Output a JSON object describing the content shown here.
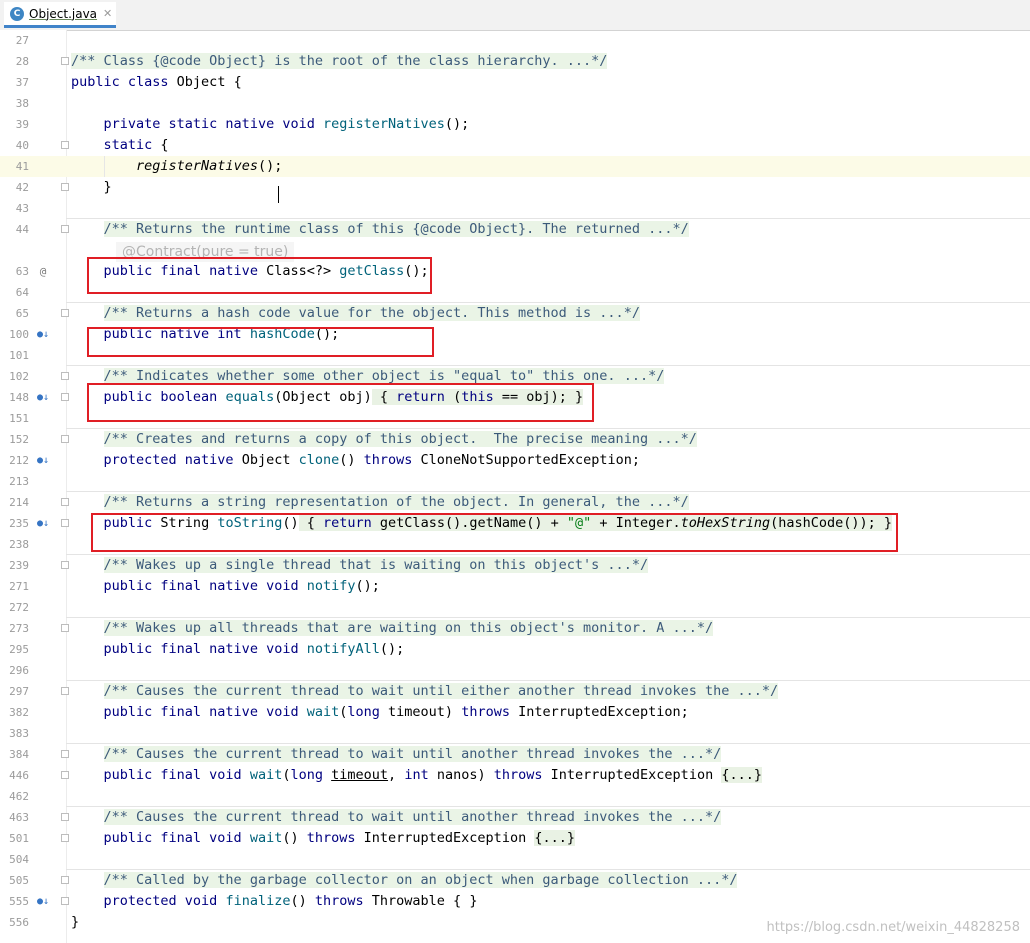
{
  "tab": {
    "icon": "java-class-icon",
    "icon_letter": "C",
    "filename": "Object.java",
    "close_symbol": "✕"
  },
  "inlay_hint": "@Contract(pure = true)",
  "watermark": "https://blog.csdn.net/weixin_44828258",
  "lines": [
    {
      "num": "27",
      "tokens": []
    },
    {
      "num": "28",
      "fold": true,
      "tokens": [
        {
          "t": "/** Class {@code Object} is the root of the class hierarchy. ...*/",
          "c": "doc"
        }
      ]
    },
    {
      "num": "37",
      "tokens": [
        {
          "t": "public class",
          "c": "kw"
        },
        {
          "t": " Object {"
        }
      ]
    },
    {
      "num": "38",
      "tokens": []
    },
    {
      "num": "39",
      "tokens": [
        {
          "t": "    "
        },
        {
          "t": "private static native void",
          "c": "kw"
        },
        {
          "t": " "
        },
        {
          "t": "registerNatives",
          "c": "mth"
        },
        {
          "t": "();"
        }
      ]
    },
    {
      "num": "40",
      "fold": true,
      "tokens": [
        {
          "t": "    "
        },
        {
          "t": "static",
          "c": "kw"
        },
        {
          "t": " {"
        }
      ]
    },
    {
      "num": "41",
      "current": true,
      "tokens": [
        {
          "t": "        "
        },
        {
          "t": "registerNatives",
          "c": "it"
        },
        {
          "t": "();"
        }
      ]
    },
    {
      "num": "42",
      "fold": true,
      "tokens": [
        {
          "t": "    }"
        }
      ]
    },
    {
      "num": "43",
      "tokens": []
    },
    {
      "num": "44",
      "fold": true,
      "tokens": [
        {
          "t": "    "
        },
        {
          "t": "/** Returns the runtime class of this {@code Object}. The returned ...*/",
          "c": "doc"
        }
      ]
    },
    {
      "num": "",
      "tokens": []
    },
    {
      "num": "63",
      "icon": "@",
      "tokens": [
        {
          "t": "    "
        },
        {
          "t": "public final native",
          "c": "kw"
        },
        {
          "t": " Class<?> "
        },
        {
          "t": "getClass",
          "c": "mth"
        },
        {
          "t": "();"
        }
      ]
    },
    {
      "num": "64",
      "tokens": []
    },
    {
      "num": "65",
      "fold": true,
      "tokens": [
        {
          "t": "    "
        },
        {
          "t": "/** Returns a hash code value for the object. This method is ...*/",
          "c": "doc"
        }
      ]
    },
    {
      "num": "100",
      "icon": "override",
      "tokens": [
        {
          "t": "    "
        },
        {
          "t": "public native int",
          "c": "kw"
        },
        {
          "t": " "
        },
        {
          "t": "hashCode",
          "c": "mth"
        },
        {
          "t": "();"
        }
      ]
    },
    {
      "num": "101",
      "tokens": []
    },
    {
      "num": "102",
      "fold": true,
      "tokens": [
        {
          "t": "    "
        },
        {
          "t": "/** Indicates whether some other object is \"equal to\" this one. ...*/",
          "c": "doc"
        }
      ]
    },
    {
      "num": "148",
      "icon": "override",
      "fold": true,
      "tokens": [
        {
          "t": "    "
        },
        {
          "t": "public boolean",
          "c": "kw"
        },
        {
          "t": " "
        },
        {
          "t": "equals",
          "c": "mth"
        },
        {
          "t": "(Object obj)"
        },
        {
          "t": " { ",
          "c": "fb"
        },
        {
          "t": "return",
          "c": "kw fb"
        },
        {
          "t": " (",
          "c": "fb"
        },
        {
          "t": "this",
          "c": "kw fb"
        },
        {
          "t": " == obj); ",
          "c": "fb"
        },
        {
          "t": "}",
          "c": "fb"
        }
      ]
    },
    {
      "num": "151",
      "tokens": []
    },
    {
      "num": "152",
      "fold": true,
      "tokens": [
        {
          "t": "    "
        },
        {
          "t": "/** Creates and returns a copy of this object.  The precise meaning ...*/",
          "c": "doc"
        }
      ]
    },
    {
      "num": "212",
      "icon": "override",
      "tokens": [
        {
          "t": "    "
        },
        {
          "t": "protected native",
          "c": "kw"
        },
        {
          "t": " Object "
        },
        {
          "t": "clone",
          "c": "mth"
        },
        {
          "t": "() "
        },
        {
          "t": "throws",
          "c": "kw"
        },
        {
          "t": " CloneNotSupportedException;"
        }
      ]
    },
    {
      "num": "213",
      "tokens": []
    },
    {
      "num": "214",
      "fold": true,
      "tokens": [
        {
          "t": "    "
        },
        {
          "t": "/** Returns a string representation of the object. In general, the ...*/",
          "c": "doc"
        }
      ]
    },
    {
      "num": "235",
      "icon": "override",
      "fold": true,
      "tokens": [
        {
          "t": "    "
        },
        {
          "t": "public",
          "c": "kw"
        },
        {
          "t": " String "
        },
        {
          "t": "toString",
          "c": "mth"
        },
        {
          "t": "()"
        },
        {
          "t": " { ",
          "c": "fb"
        },
        {
          "t": "return",
          "c": "kw fb"
        },
        {
          "t": " getClass().getName() + ",
          "c": "fb"
        },
        {
          "t": "\"@\"",
          "c": "str fb"
        },
        {
          "t": " + Integer.",
          "c": "fb"
        },
        {
          "t": "toHexString",
          "c": "it fb"
        },
        {
          "t": "(hashCode()); ",
          "c": "fb"
        },
        {
          "t": "}",
          "c": "fb"
        }
      ]
    },
    {
      "num": "238",
      "tokens": []
    },
    {
      "num": "239",
      "fold": true,
      "tokens": [
        {
          "t": "    "
        },
        {
          "t": "/** Wakes up a single thread that is waiting on this object's ...*/",
          "c": "doc"
        }
      ]
    },
    {
      "num": "271",
      "tokens": [
        {
          "t": "    "
        },
        {
          "t": "public final native void",
          "c": "kw"
        },
        {
          "t": " "
        },
        {
          "t": "notify",
          "c": "mth"
        },
        {
          "t": "();"
        }
      ]
    },
    {
      "num": "272",
      "tokens": []
    },
    {
      "num": "273",
      "fold": true,
      "tokens": [
        {
          "t": "    "
        },
        {
          "t": "/** Wakes up all threads that are waiting on this object's monitor. A ...*/",
          "c": "doc"
        }
      ]
    },
    {
      "num": "295",
      "tokens": [
        {
          "t": "    "
        },
        {
          "t": "public final native void",
          "c": "kw"
        },
        {
          "t": " "
        },
        {
          "t": "notifyAll",
          "c": "mth"
        },
        {
          "t": "();"
        }
      ]
    },
    {
      "num": "296",
      "tokens": []
    },
    {
      "num": "297",
      "fold": true,
      "tokens": [
        {
          "t": "    "
        },
        {
          "t": "/** Causes the current thread to wait until either another thread invokes the ...*/",
          "c": "doc"
        }
      ]
    },
    {
      "num": "382",
      "tokens": [
        {
          "t": "    "
        },
        {
          "t": "public final native void",
          "c": "kw"
        },
        {
          "t": " "
        },
        {
          "t": "wait",
          "c": "mth"
        },
        {
          "t": "("
        },
        {
          "t": "long",
          "c": "kw"
        },
        {
          "t": " timeout) "
        },
        {
          "t": "throws",
          "c": "kw"
        },
        {
          "t": " InterruptedException;"
        }
      ]
    },
    {
      "num": "383",
      "tokens": []
    },
    {
      "num": "384",
      "fold": true,
      "tokens": [
        {
          "t": "    "
        },
        {
          "t": "/** Causes the current thread to wait until another thread invokes the ...*/",
          "c": "doc"
        }
      ]
    },
    {
      "num": "446",
      "fold": true,
      "tokens": [
        {
          "t": "    "
        },
        {
          "t": "public final void",
          "c": "kw"
        },
        {
          "t": " "
        },
        {
          "t": "wait",
          "c": "mth"
        },
        {
          "t": "("
        },
        {
          "t": "long",
          "c": "kw"
        },
        {
          "t": " "
        },
        {
          "t": "timeout",
          "c": "ul"
        },
        {
          "t": ", "
        },
        {
          "t": "int",
          "c": "kw"
        },
        {
          "t": " nanos) "
        },
        {
          "t": "throws",
          "c": "kw"
        },
        {
          "t": " InterruptedException "
        },
        {
          "t": "{...}",
          "c": "fb"
        }
      ]
    },
    {
      "num": "462",
      "tokens": []
    },
    {
      "num": "463",
      "fold": true,
      "tokens": [
        {
          "t": "    "
        },
        {
          "t": "/** Causes the current thread to wait until another thread invokes the ...*/",
          "c": "doc"
        }
      ]
    },
    {
      "num": "501",
      "fold": true,
      "tokens": [
        {
          "t": "    "
        },
        {
          "t": "public final void",
          "c": "kw"
        },
        {
          "t": " "
        },
        {
          "t": "wait",
          "c": "mth"
        },
        {
          "t": "() "
        },
        {
          "t": "throws",
          "c": "kw"
        },
        {
          "t": " InterruptedException "
        },
        {
          "t": "{...}",
          "c": "fb"
        }
      ]
    },
    {
      "num": "504",
      "tokens": []
    },
    {
      "num": "505",
      "fold": true,
      "tokens": [
        {
          "t": "    "
        },
        {
          "t": "/** Called by the garbage collector on an object when garbage collection ...*/",
          "c": "doc"
        }
      ]
    },
    {
      "num": "555",
      "icon": "override",
      "fold": true,
      "tokens": [
        {
          "t": "    "
        },
        {
          "t": "protected void",
          "c": "kw"
        },
        {
          "t": " "
        },
        {
          "t": "finalize",
          "c": "mth"
        },
        {
          "t": "() "
        },
        {
          "t": "throws",
          "c": "kw"
        },
        {
          "t": " Throwable { }"
        }
      ]
    },
    {
      "num": "556",
      "tokens": [
        {
          "t": "}"
        }
      ]
    }
  ]
}
